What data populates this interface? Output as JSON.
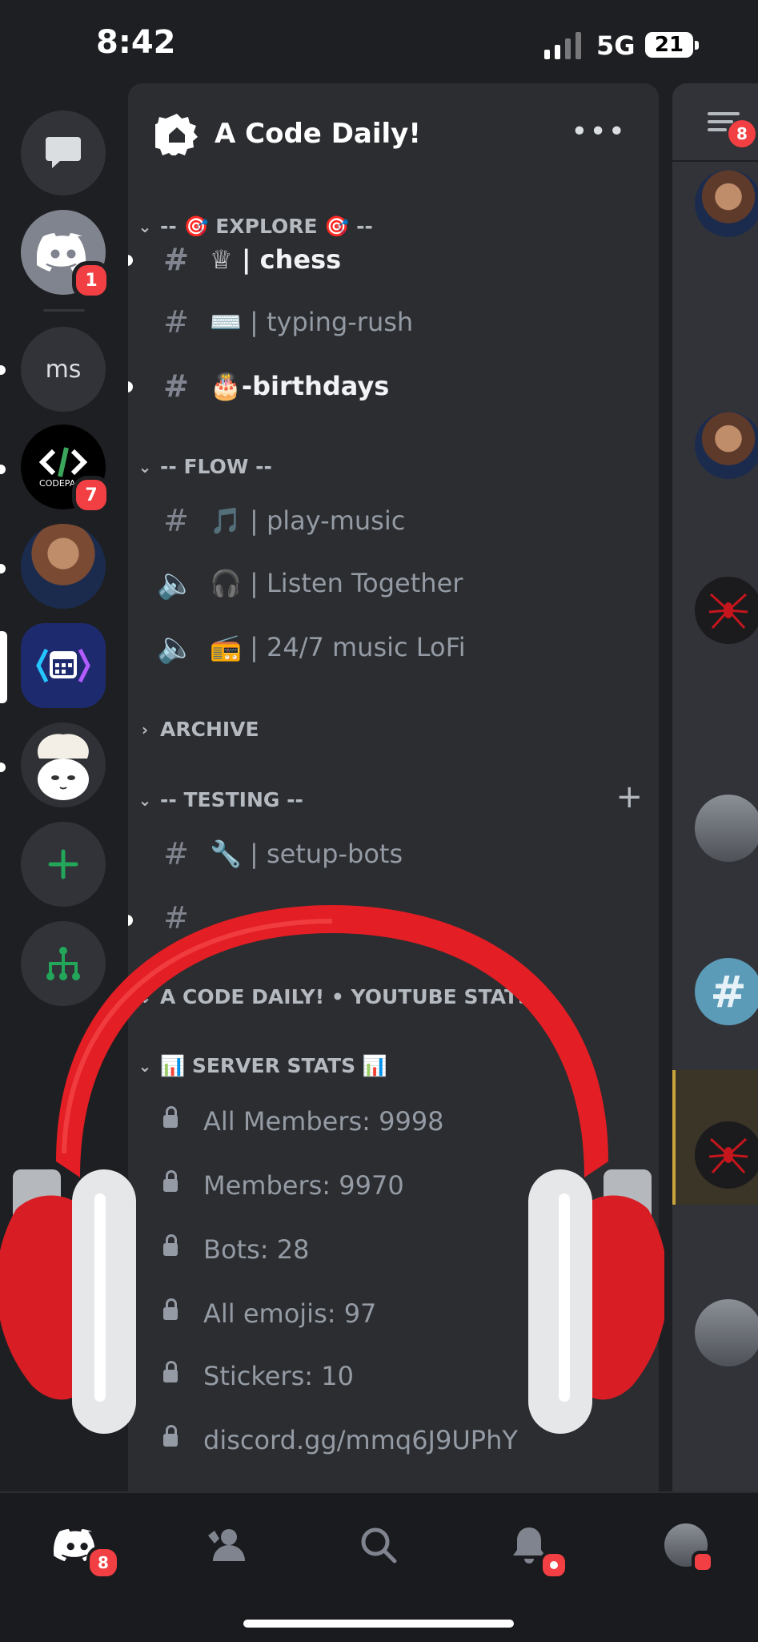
{
  "status": {
    "time": "8:42",
    "network": "5G",
    "battery": "21"
  },
  "servers": [
    {
      "name": "direct-messages",
      "badge": ""
    },
    {
      "name": "discord-home",
      "badge": "1"
    },
    {
      "name": "ms",
      "label": "ms",
      "badge": ""
    },
    {
      "name": "codepack",
      "label": "CODEPACK",
      "badge": "7"
    },
    {
      "name": "avatar-server",
      "badge": ""
    },
    {
      "name": "a-code-daily",
      "badge": ""
    },
    {
      "name": "chef-server",
      "badge": ""
    }
  ],
  "server_header": {
    "name": "A Code Daily!",
    "more": "•••"
  },
  "categories": {
    "explore": "-- 🎯 EXPLORE 🎯 --",
    "flow": "-- FLOW --",
    "archive": "ARCHIVE",
    "testing": "-- TESTING --",
    "youtube": "A CODE DAILY! • YOUTUBE STATS",
    "server_stats": "📊 SERVER STATS 📊"
  },
  "channels": {
    "chess": "♕ | chess",
    "typing": "⌨️ | typing-rush",
    "birthdays": "🎂-birthdays",
    "play_music": "🎵 | play-music",
    "listen": "🎧 | Listen Together",
    "lofi": "📻 | 24/7 music LoFi",
    "setup_bots": "🔧 | setup-bots"
  },
  "stats": {
    "all_members": "All Members: 9998",
    "members": "Members: 9970",
    "bots": "Bots: 28",
    "emojis": "All emojis: 97",
    "stickers": "Stickers: 10",
    "invite": "discord.gg/mmq6J9UPhY"
  },
  "peek": {
    "badge": "8"
  },
  "tabs": {
    "home_badge": "8"
  },
  "colors": {
    "bg": "#1e1f22",
    "panel": "#2b2d31",
    "badge": "#f23f43",
    "green": "#23a55a",
    "blurple": "#5865f2"
  }
}
